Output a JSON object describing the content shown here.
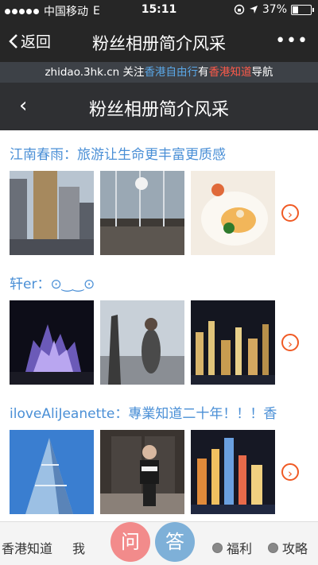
{
  "status": {
    "carrier": "中国移动",
    "network": "E",
    "time": "15:11",
    "battery": "37%",
    "battery_level": 0.37
  },
  "nav": {
    "back_label": "返回",
    "title": "粉丝相册简介风采",
    "more": "•••"
  },
  "banner": {
    "part1": "zhidao.3hk.cn 关注",
    "link1": "香港自由行",
    "part2": "有",
    "link2": "香港知道",
    "part3": "导航"
  },
  "page": {
    "back": "‹",
    "title": "粉丝相册简介风采"
  },
  "sections": [
    {
      "header": "江南春雨：旅游让生命更丰富更质感"
    },
    {
      "header": "轩er：⊙‿‿⊙"
    },
    {
      "header": "iloveAliJeanette：專業知道二十年！！！香"
    }
  ],
  "tabbar": {
    "item1": "香港知道",
    "item2": "我",
    "ask": "问",
    "answer": "答",
    "item3": "福利",
    "item4": "攻略"
  }
}
